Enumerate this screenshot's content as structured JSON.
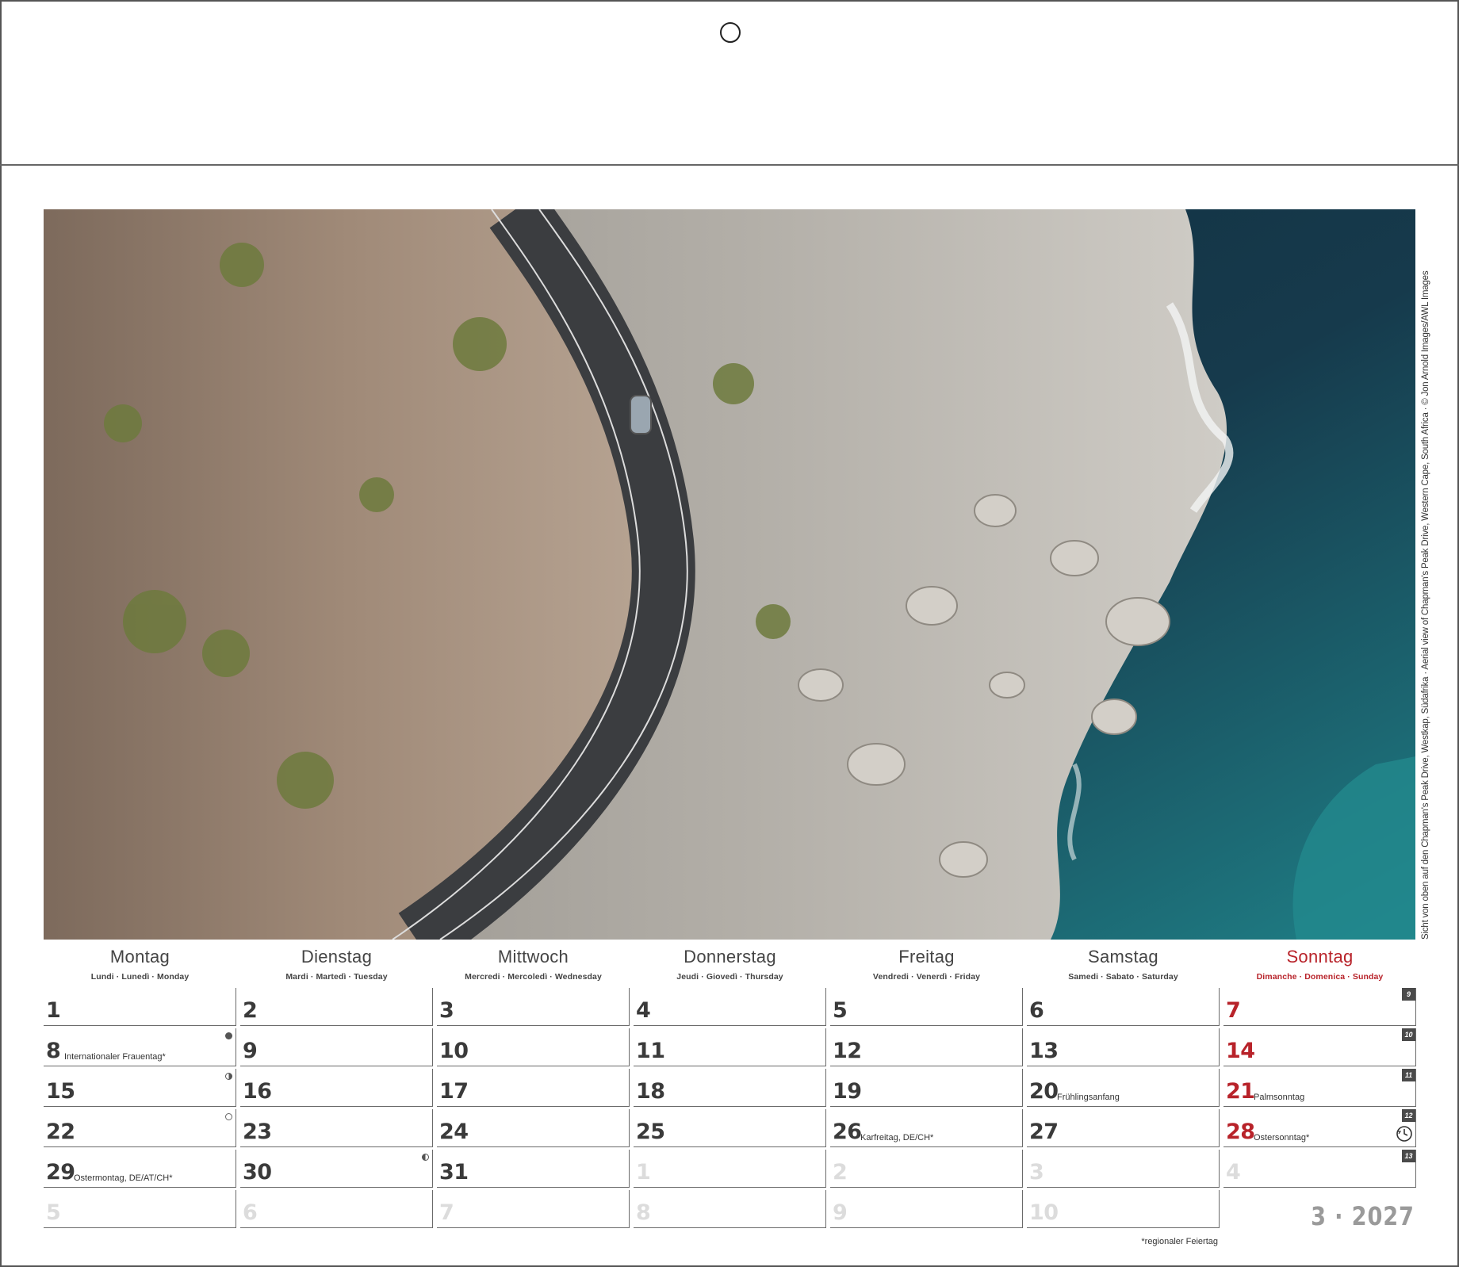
{
  "photo": {
    "alt_subject": "Aerial coastal road",
    "credit": "Sicht von oben auf den Chapman's Peak Drive, Westkap, Südafrika · Aerial view of Chapman's Peak Drive, Western Cape, South Africa · © Jon Arnold Images/AWL Images"
  },
  "days": [
    {
      "name": "Montag",
      "sub": "Lundi · Lunedì · Monday"
    },
    {
      "name": "Dienstag",
      "sub": "Mardi · Martedì · Tuesday"
    },
    {
      "name": "Mittwoch",
      "sub": "Mercredi · Mercoledì · Wednesday"
    },
    {
      "name": "Donnerstag",
      "sub": "Jeudi · Giovedì · Thursday"
    },
    {
      "name": "Freitag",
      "sub": "Vendredi · Venerdì · Friday"
    },
    {
      "name": "Samstag",
      "sub": "Samedi · Sabato · Saturday"
    },
    {
      "name": "Sonntag",
      "sub": "Dimanche · Domenica · Sunday"
    }
  ],
  "rows": [
    {
      "week": "9",
      "cells": [
        {
          "n": "1"
        },
        {
          "n": "2"
        },
        {
          "n": "3"
        },
        {
          "n": "4"
        },
        {
          "n": "5"
        },
        {
          "n": "6"
        },
        {
          "n": "7"
        }
      ]
    },
    {
      "week": "10",
      "cells": [
        {
          "n": "8",
          "note": "Internationaler Frauentag*",
          "moon": "new"
        },
        {
          "n": "9"
        },
        {
          "n": "10"
        },
        {
          "n": "11"
        },
        {
          "n": "12"
        },
        {
          "n": "13"
        },
        {
          "n": "14"
        }
      ]
    },
    {
      "week": "11",
      "cells": [
        {
          "n": "15",
          "moon": "first"
        },
        {
          "n": "16"
        },
        {
          "n": "17"
        },
        {
          "n": "18"
        },
        {
          "n": "19"
        },
        {
          "n": "20",
          "note": "Frühlingsanfang"
        },
        {
          "n": "21",
          "note": "Palmsonntag"
        }
      ]
    },
    {
      "week": "12",
      "cells": [
        {
          "n": "22",
          "moon": "full"
        },
        {
          "n": "23"
        },
        {
          "n": "24"
        },
        {
          "n": "25"
        },
        {
          "n": "26",
          "note": "Karfreitag, DE/CH*"
        },
        {
          "n": "27"
        },
        {
          "n": "28",
          "note": "Ostersonntag*",
          "clock": true
        }
      ]
    },
    {
      "week": "13",
      "cells": [
        {
          "n": "29",
          "note": "Ostermontag, DE/AT/CH*"
        },
        {
          "n": "30",
          "moon": "last"
        },
        {
          "n": "31"
        },
        {
          "n": "1",
          "other": true
        },
        {
          "n": "2",
          "other": true
        },
        {
          "n": "3",
          "other": true
        },
        {
          "n": "4",
          "other": true
        }
      ]
    },
    {
      "week": "",
      "cells": [
        {
          "n": "5",
          "other": true
        },
        {
          "n": "6",
          "other": true
        },
        {
          "n": "7",
          "other": true
        },
        {
          "n": "8",
          "other": true
        },
        {
          "n": "9",
          "other": true
        },
        {
          "n": "10",
          "other": true
        }
      ]
    }
  ],
  "footnote": "*regionaler Feiertag",
  "month_label": "3 · 2027",
  "colors": {
    "sunday": "#b8232a",
    "text": "#3a3a3a",
    "muted": "#dcdcdc",
    "week_badge": "#4a4a4a"
  }
}
